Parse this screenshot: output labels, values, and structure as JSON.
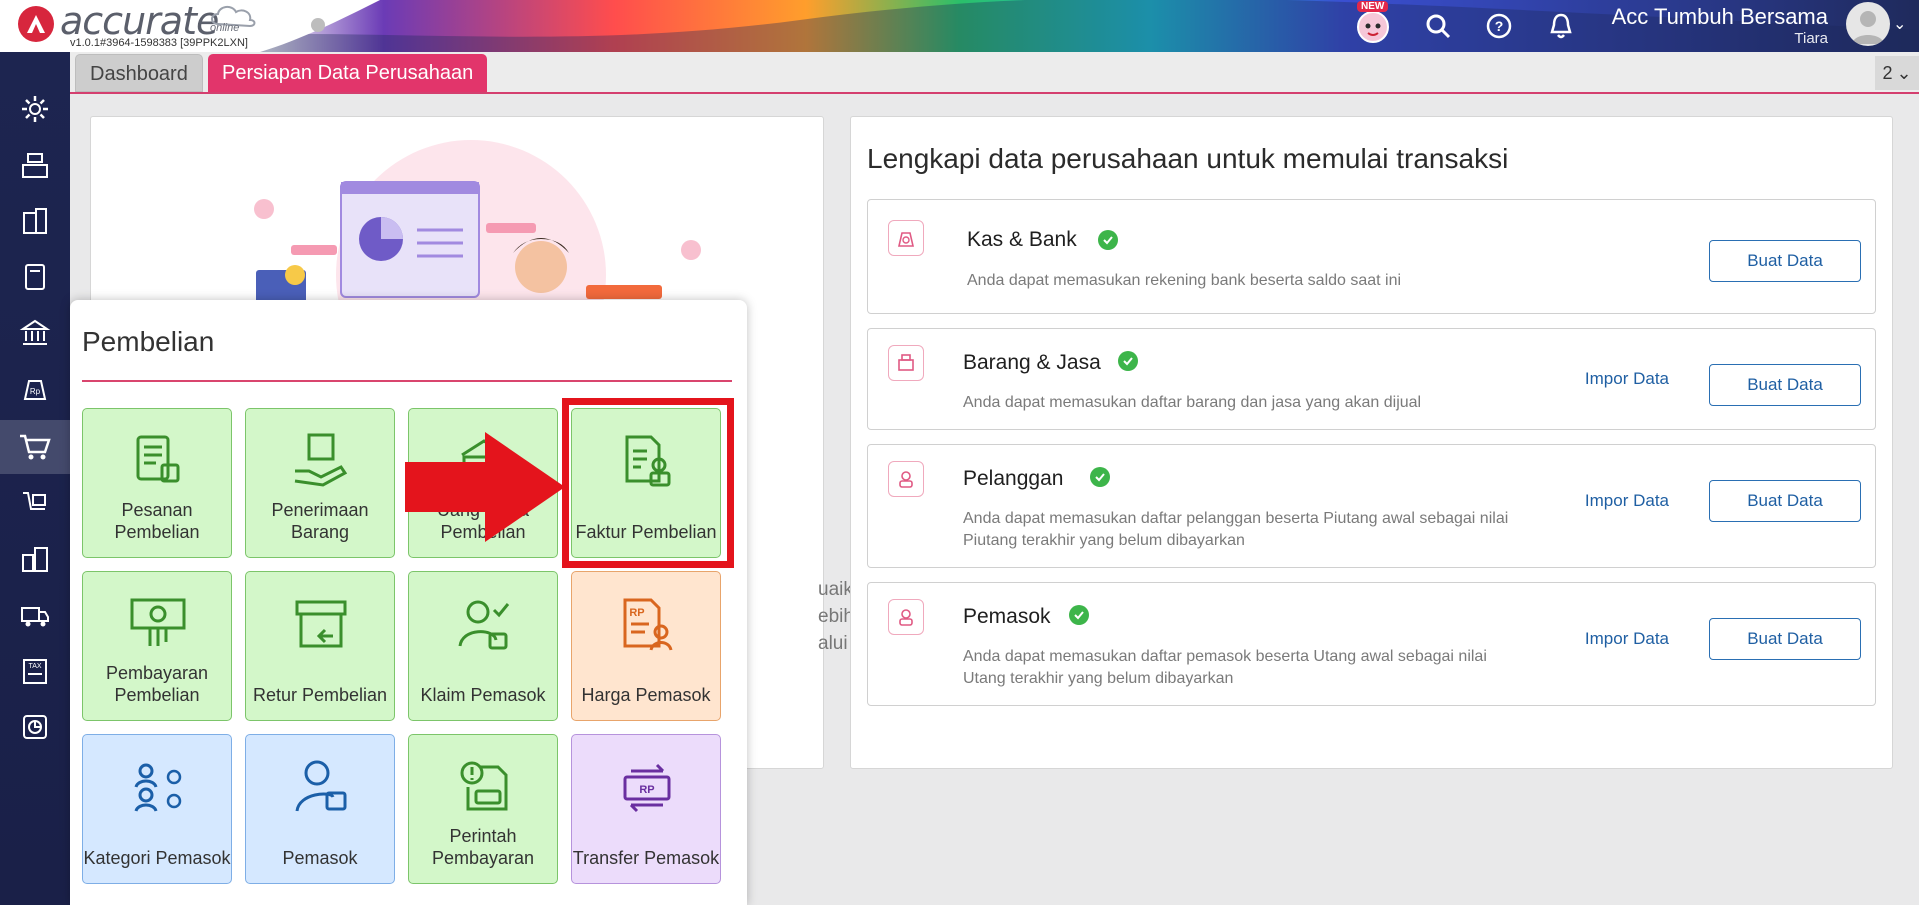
{
  "header": {
    "logo_text": "accurate",
    "logo_sub": "online",
    "version": "v1.0.1#3964-1598383 [39PPK2LXN]",
    "new_badge": "NEW",
    "company_name": "Acc Tumbuh Bersama",
    "user_name": "Tiara",
    "icons": [
      "notification-mascot-icon",
      "search-icon",
      "help-icon",
      "bell-icon",
      "avatar-icon",
      "chevron-down-icon"
    ]
  },
  "sidebar": {
    "items": [
      "settings",
      "inventory",
      "company",
      "ledger",
      "bank",
      "receivables",
      "purchase",
      "delivery",
      "assets",
      "warehouse",
      "tax",
      "reports"
    ],
    "active": "purchase"
  },
  "tabs": [
    {
      "label": "Dashboard"
    },
    {
      "label": "Persiapan Data Perusahaan"
    }
  ],
  "tab_count": "2",
  "left_panel": {
    "partial_text": [
      "uaikan",
      "ebih",
      "alui"
    ]
  },
  "right_panel": {
    "title": "Lengkapi data perusahaan untuk memulai transaksi",
    "cards": [
      {
        "title": "Kas & Bank",
        "desc": "Anda dapat memasukan rekening bank beserta saldo saat ini",
        "import": "",
        "create": "Buat Data"
      },
      {
        "title": "Barang & Jasa",
        "desc": "Anda dapat memasukan daftar barang dan jasa yang akan dijual",
        "import": "Impor Data",
        "create": "Buat Data"
      },
      {
        "title": "Pelanggan",
        "desc": "Anda dapat memasukan daftar pelanggan beserta Piutang awal sebagai nilai Piutang terakhir yang belum dibayarkan",
        "import": "Impor Data",
        "create": "Buat Data"
      },
      {
        "title": "Pemasok",
        "desc": "Anda dapat memasukan daftar pemasok beserta Utang awal sebagai nilai Utang terakhir yang belum dibayarkan",
        "import": "Impor Data",
        "create": "Buat Data"
      }
    ]
  },
  "menu": {
    "title": "Pembelian",
    "tiles": [
      {
        "label": "Pesanan Pembelian",
        "color": "green"
      },
      {
        "label": "Penerimaan Barang",
        "color": "green"
      },
      {
        "label": "Uang Muka Pembelian",
        "color": "green"
      },
      {
        "label": "Faktur Pembelian",
        "color": "green"
      },
      {
        "label": "Pembayaran Pembelian",
        "color": "green"
      },
      {
        "label": "Retur Pembelian",
        "color": "green"
      },
      {
        "label": "Klaim Pemasok",
        "color": "green"
      },
      {
        "label": "Harga Pemasok",
        "color": "orange"
      },
      {
        "label": "Kategori Pemasok",
        "color": "blue"
      },
      {
        "label": "Pemasok",
        "color": "blue"
      },
      {
        "label": "Perintah Pembayaran",
        "color": "green"
      },
      {
        "label": "Transfer Pemasok",
        "color": "purple"
      }
    ]
  },
  "colors": {
    "accent": "#e2356b",
    "highlight": "#e4141c",
    "link": "#1f5fa3",
    "check": "#3db54a"
  }
}
